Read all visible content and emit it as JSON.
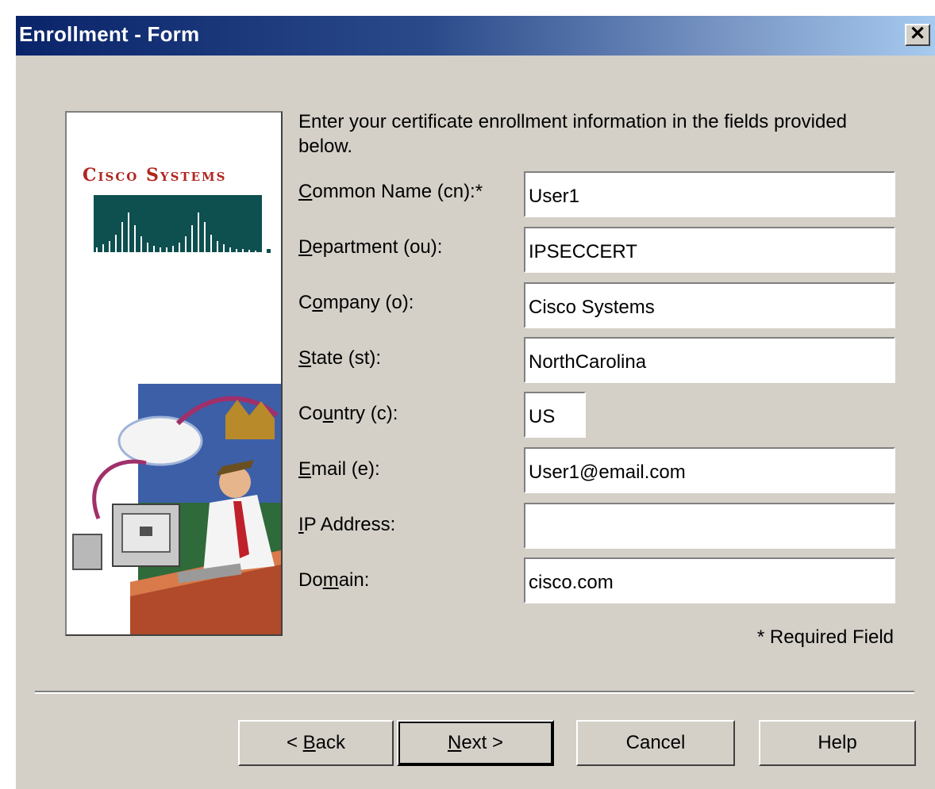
{
  "window": {
    "title": "Enrollment - Form",
    "close_symbol": "✕"
  },
  "branding": {
    "logo_text": "Cisco Systems"
  },
  "instructions": "Enter your certificate enrollment information in the fields provided below.",
  "fields": [
    {
      "label": "Common Name (cn):*",
      "access_key_index": 0,
      "value": "User1"
    },
    {
      "label": "Department (ou):",
      "access_key_index": 0,
      "value": "IPSECCERT"
    },
    {
      "label": "Company (o):",
      "access_key_index": 1,
      "value": "Cisco Systems"
    },
    {
      "label": "State (st):",
      "access_key_index": 0,
      "value": "NorthCarolina"
    },
    {
      "label": "Country (c):",
      "access_key_index": 2,
      "value": "US"
    },
    {
      "label": "Email (e):",
      "access_key_index": 0,
      "value": "User1@email.com"
    },
    {
      "label": "IP Address:",
      "access_key_index": 0,
      "value": ""
    },
    {
      "label": "Domain:",
      "access_key_index": 2,
      "value": "cisco.com"
    }
  ],
  "required_note": "* Required Field",
  "buttons": {
    "back": {
      "prefix": "< ",
      "key": "B",
      "rest": "ack"
    },
    "next": {
      "key": "N",
      "rest": "ext >"
    },
    "cancel": "Cancel",
    "help": "Help"
  }
}
